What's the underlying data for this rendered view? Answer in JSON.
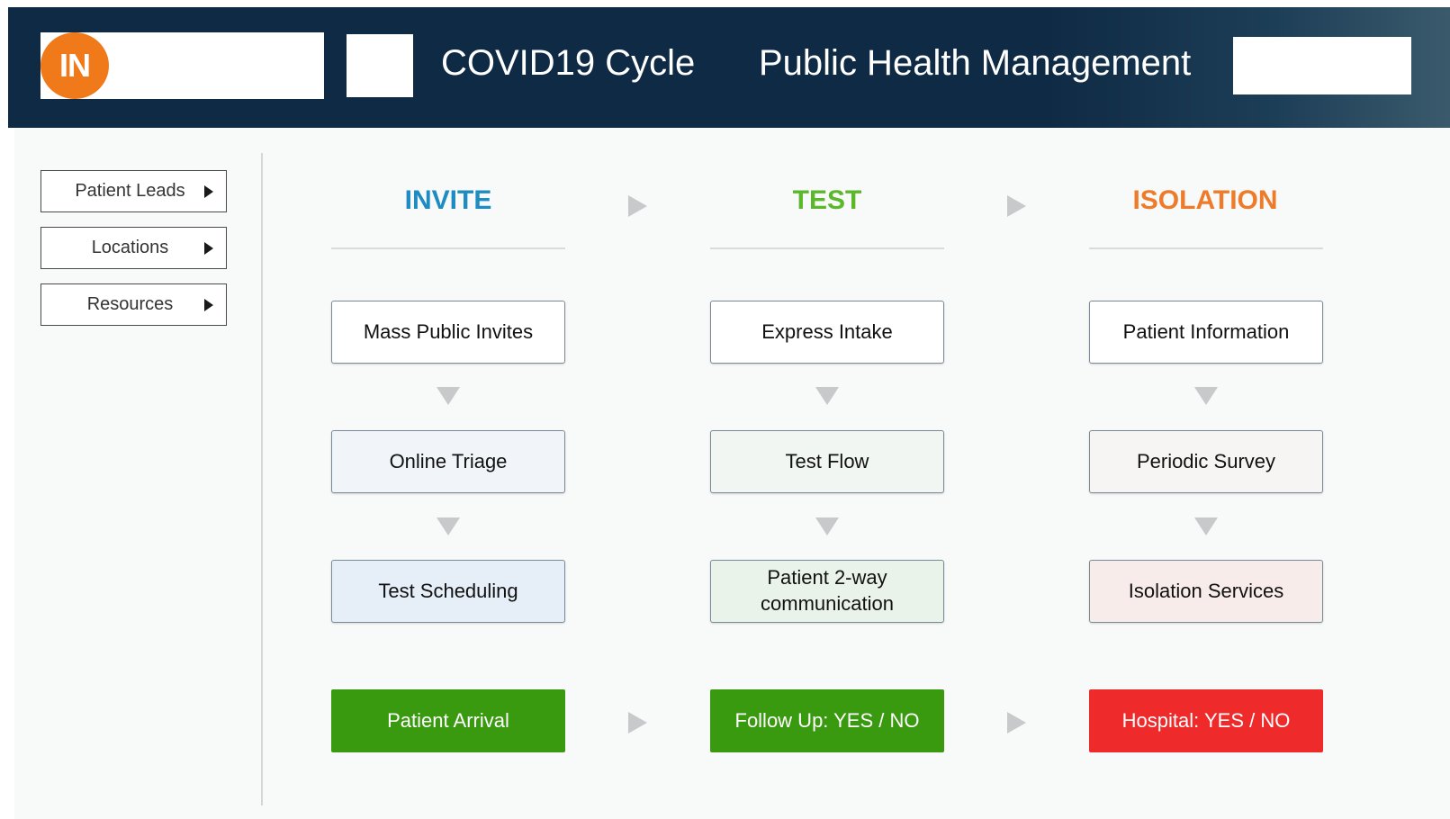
{
  "header": {
    "logo_text": "IN",
    "title": "COVID19 Cycle",
    "subtitle": "Public Health Management"
  },
  "sidebar": {
    "items": [
      {
        "label": "Patient Leads"
      },
      {
        "label": "Locations"
      },
      {
        "label": "Resources"
      }
    ]
  },
  "columns": [
    {
      "heading": "INVITE",
      "color": "#1e8bc3",
      "steps": [
        "Mass Public Invites",
        "Online Triage",
        "Test Scheduling"
      ],
      "step_colors": [
        "#ffffff",
        "#f1f5fa",
        "#e6eef8"
      ],
      "action": {
        "label": "Patient Arrival",
        "color": "#3a9a0f"
      }
    },
    {
      "heading": "TEST",
      "color": "#5ab82a",
      "steps": [
        "Express Intake",
        "Test Flow",
        "Patient 2-way communication"
      ],
      "step_colors": [
        "#ffffff",
        "#f2f6f2",
        "#eaf3ea"
      ],
      "action": {
        "label": "Follow Up: YES / NO",
        "color": "#3a9a0f"
      }
    },
    {
      "heading": "ISOLATION",
      "color": "#ee7b2a",
      "steps": [
        "Patient Information",
        "Periodic Survey",
        "Isolation Services"
      ],
      "step_colors": [
        "#ffffff",
        "#f7f5f4",
        "#f8ecea"
      ],
      "action": {
        "label": "Hospital: YES / NO",
        "color": "#ee2a2a"
      }
    }
  ]
}
